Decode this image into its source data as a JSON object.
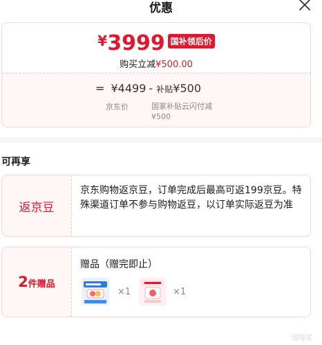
{
  "header": {
    "title": "优惠"
  },
  "price_card": {
    "currency": "¥",
    "final_price": "3999",
    "tag": "国补领后价",
    "save_text": "购买立减",
    "save_amount": "¥500.00",
    "formula": {
      "equals": "=",
      "jd_price": "¥4499",
      "minus": "-",
      "subsidy_word": "补贴",
      "subsidy_amount": "¥500"
    },
    "jd_price_label": "京东价",
    "subsidy_label_line1": "国家补贴云闪付减",
    "subsidy_label_line2": "¥500"
  },
  "section": {
    "title": "可再享"
  },
  "beans": {
    "label": "返京豆",
    "desc": "京东购物返京豆，订单完成后最高可返199京豆。特殊渠道订单不参与购物返豆，以订单实际返豆为准"
  },
  "gifts": {
    "count": "2",
    "label": "件赠品",
    "title": "赠品（赠完即止）",
    "items": [
      {
        "qty": "×1"
      },
      {
        "qty": "×1"
      }
    ]
  },
  "watermark": "值得买"
}
